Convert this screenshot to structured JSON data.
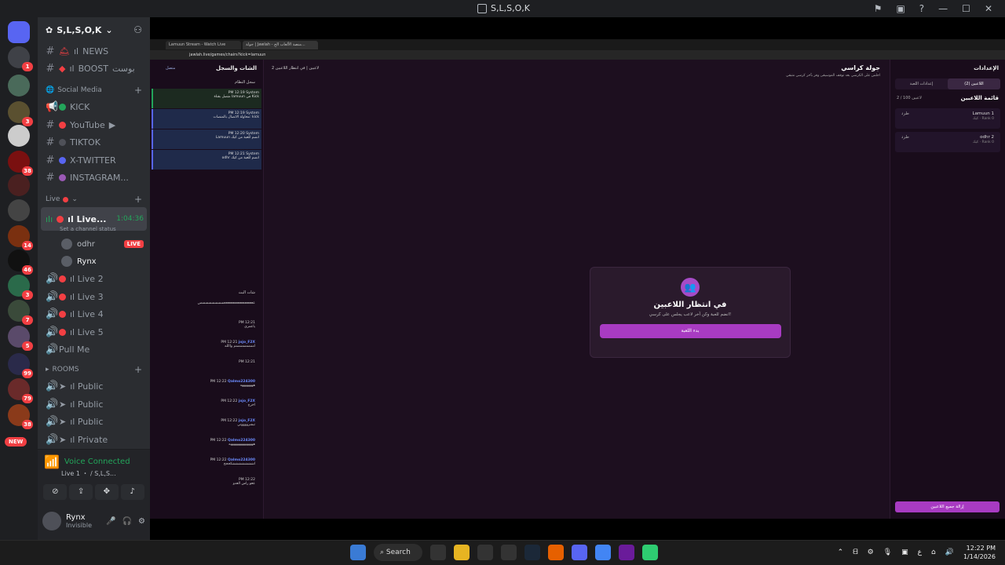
{
  "window": {
    "title": "S,L,S,O,K"
  },
  "server": {
    "name": "S,L,S,O,K"
  },
  "channels": [
    {
      "name": "NEWS",
      "prefix": "ıl",
      "type": "text"
    },
    {
      "name": "BOOST",
      "prefix": "ıl",
      "suffix": "بوست",
      "type": "text"
    }
  ],
  "social_media": {
    "label": "Social Media",
    "items": [
      {
        "name": "KICK",
        "color": "#23a55a"
      },
      {
        "name": "YouTube",
        "color": "#f23f43"
      },
      {
        "name": "TIKTOK",
        "color": "#4e5058"
      },
      {
        "name": "X-TWITTER",
        "color": "#5865f2"
      },
      {
        "name": "INSTAGRAM...",
        "color": "#9b59b6"
      }
    ]
  },
  "live": {
    "label": "Live",
    "active_channel": {
      "name": "ıl Live...",
      "timer": "1:04:36",
      "status": "Set a channel status"
    },
    "users": [
      {
        "name": "odhr",
        "live": "LIVE"
      },
      {
        "name": "Rynx"
      }
    ],
    "others": [
      "ıl Live 2",
      "ıl Live 3",
      "ıl Live 4",
      "ıl Live 5",
      "Pull Me"
    ]
  },
  "rooms": {
    "label": "ROOMS",
    "items": [
      "ıl Public",
      "ıl Public",
      "ıl Public",
      "ıl Private"
    ]
  },
  "voice_panel": {
    "title": "Voice Connected",
    "subtitle": "Live 1 ・ / S,L,S..."
  },
  "user_panel": {
    "name": "Rynx",
    "status": "Invisible"
  },
  "rail_badges": [
    "1",
    "",
    "3",
    "",
    "38",
    "",
    "",
    "",
    "14",
    "46",
    "3",
    "7",
    "5",
    "99",
    "79",
    "38",
    "NEW"
  ],
  "browser": {
    "tabs": [
      "Lamuun Stream - Watch Live",
      "جولة | Jawlah - منصة الألعاب الج..."
    ],
    "address": "jawlah.live/games/chairs?kick=lamuun"
  },
  "game": {
    "left_header": "الشات والسجل",
    "left_badge": "متصل",
    "system_log": "سجل النظام",
    "system_messages": [
      {
        "user": "System",
        "time": "PM 12:19",
        "text": "متصل بقناة lamuun في Kick"
      },
      {
        "user": "System",
        "time": "PM 12:19",
        "text": "محاولة الاتصال بالمنصات: kick"
      },
      {
        "user": "System",
        "time": "PM 12:20",
        "text": "Lamuun انضم للعبة من كيك"
      },
      {
        "user": "System",
        "time": "PM 12:21",
        "text": "odhr انضم للعبة من كيك"
      }
    ],
    "live_chat": "شات البث",
    "chat": [
      {
        "user": "",
        "time": "",
        "text": "ععععععععععععععععععسسسسسسسس"
      },
      {
        "user": "",
        "time": "PM 12:21",
        "text": "ياعمري"
      },
      {
        "user": "jojo_F2X",
        "time": "PM 12:21",
        "text": "امممممممممم واالله"
      },
      {
        "user": "",
        "time": "PM 12:21",
        "text": ""
      },
      {
        "user": "Qalmo224300",
        "time": "PM 12:22",
        "text": "ههههههههه"
      },
      {
        "user": "jojo_F2X",
        "time": "PM 12:22",
        "text": "اخرج"
      },
      {
        "user": "jojo_F2X",
        "time": "PM 12:22",
        "text": "تبشرووووني"
      },
      {
        "user": "Qalmo224300",
        "time": "PM 12:22",
        "text": "هههههههههههههههه"
      },
      {
        "user": "Qalmo224300",
        "time": "PM 12:22",
        "text": "اشششششششكححح"
      },
      {
        "user": "",
        "time": "PM 12:22",
        "text": "ععو راس العدو"
      }
    ],
    "title": "جولة كراسي",
    "subtitle": "اجلس على الكرسي بعد توقف الموسيقى وفز بآخر كرسي متبقي",
    "status_left": "في انتظار اللاعبين",
    "status_count": "2 لاعبين",
    "modal": {
      "heading": "في انتظار اللاعبين",
      "text": "انضم للعبة وكن آخر لاعب يجلس على كرسي!",
      "button": "بدء اللعبة"
    },
    "settings": {
      "header": "الإعدادات",
      "tabs": [
        "اللاعبين (2)",
        "إعدادات اللعبة"
      ],
      "list_title": "قائمة اللاعبين",
      "count": "2 / 100 لاعبين",
      "players": [
        {
          "rank": "1",
          "name": "Lamuun",
          "meta": "كيك · Rank 0",
          "action": "طرد"
        },
        {
          "rank": "2",
          "name": "odhr",
          "meta": "كيك · Rank 0",
          "action": "طرد"
        }
      ],
      "remove_all": "إزالة جميع اللاعبين"
    }
  },
  "taskbar": {
    "search": "Search",
    "time": "12:22 PM",
    "date": "1/14/2026"
  }
}
